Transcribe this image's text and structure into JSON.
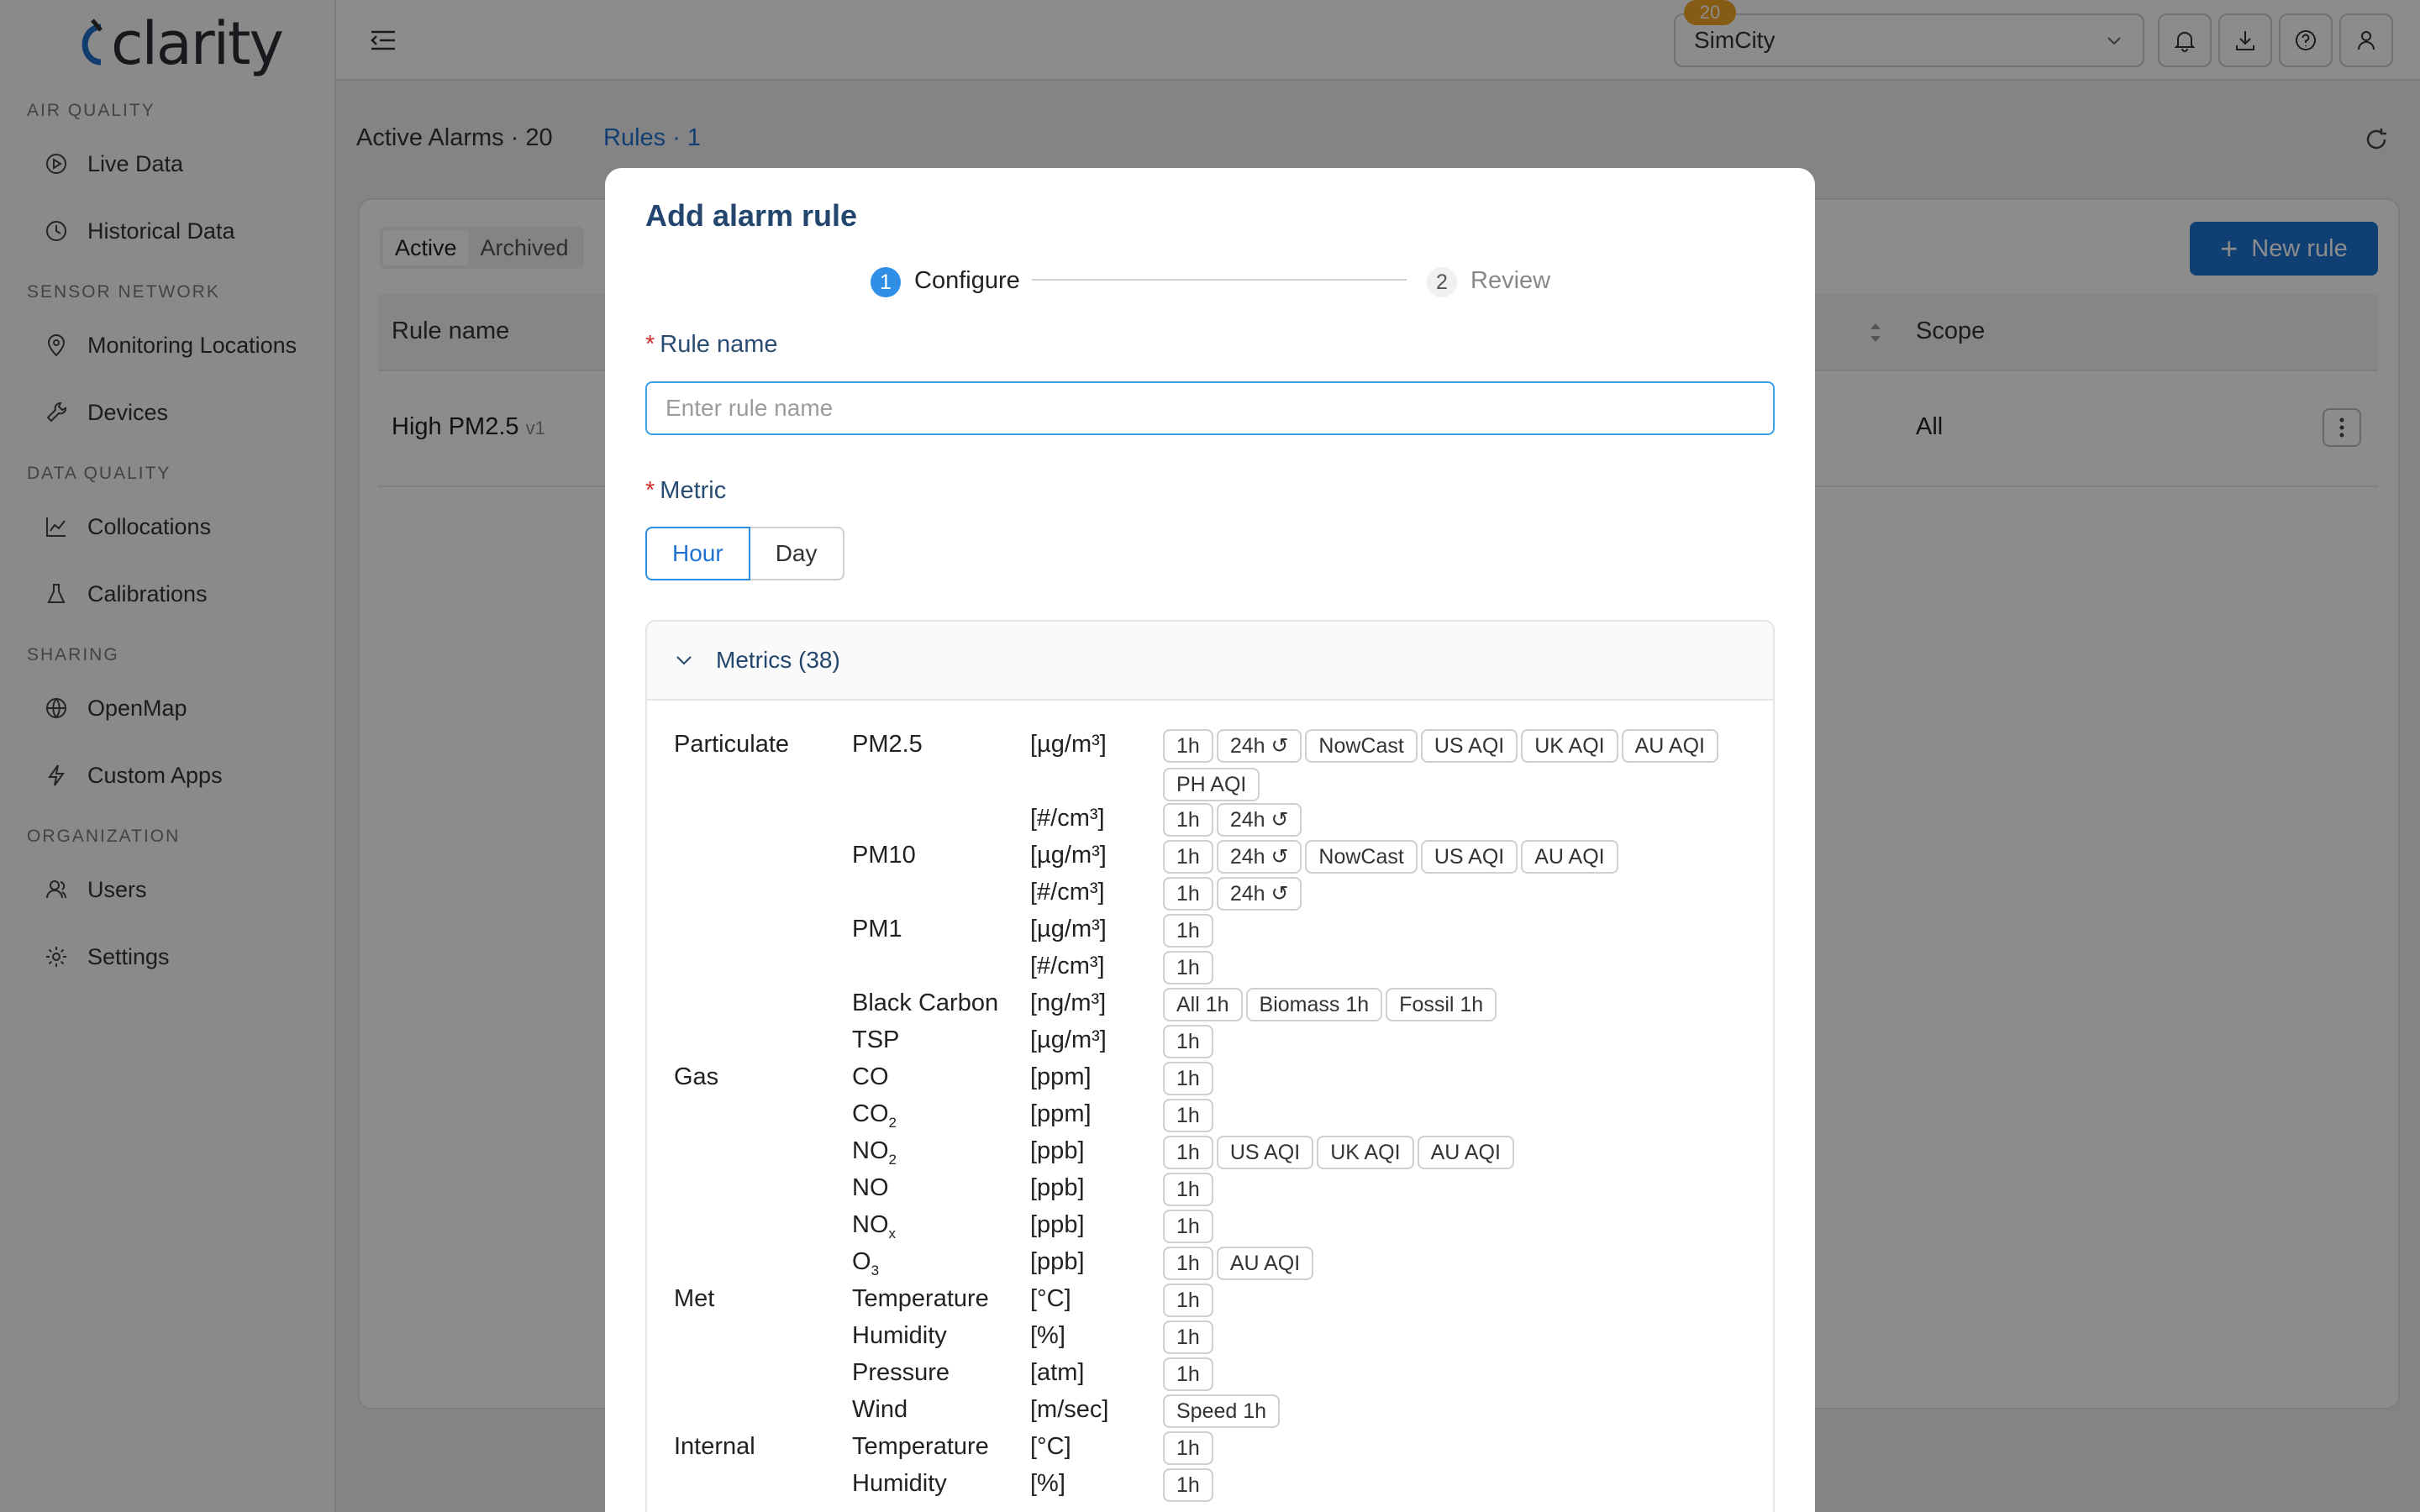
{
  "app": {
    "logo": "clarity"
  },
  "sidebar": {
    "sections": [
      {
        "label": "AIR QUALITY",
        "items": [
          {
            "label": "Live Data",
            "icon": "play-circle-icon"
          },
          {
            "label": "Historical Data",
            "icon": "clock-icon"
          }
        ]
      },
      {
        "label": "SENSOR NETWORK",
        "items": [
          {
            "label": "Monitoring Locations",
            "icon": "location-pin-icon"
          },
          {
            "label": "Devices",
            "icon": "wrench-icon"
          }
        ]
      },
      {
        "label": "DATA QUALITY",
        "items": [
          {
            "label": "Collocations",
            "icon": "line-chart-icon"
          },
          {
            "label": "Calibrations",
            "icon": "flask-icon"
          }
        ]
      },
      {
        "label": "SHARING",
        "items": [
          {
            "label": "OpenMap",
            "icon": "globe-icon"
          },
          {
            "label": "Custom Apps",
            "icon": "bolt-icon"
          }
        ]
      },
      {
        "label": "ORGANIZATION",
        "items": [
          {
            "label": "Users",
            "icon": "users-icon"
          },
          {
            "label": "Settings",
            "icon": "gear-icon"
          }
        ]
      }
    ]
  },
  "topbar": {
    "org": "SimCity",
    "notification_count": "20"
  },
  "page": {
    "tabs": [
      {
        "label": "Active Alarms · 20",
        "active": false
      },
      {
        "label": "Rules · 1",
        "active": true
      }
    ],
    "segments": [
      "Active",
      "Archived"
    ],
    "new_rule": "New rule",
    "columns": {
      "rule_name": "Rule name",
      "scope": "Scope"
    },
    "rows": [
      {
        "name": "High PM2.5",
        "version": "v1",
        "scope": "All"
      }
    ]
  },
  "modal": {
    "title": "Add alarm rule",
    "steps": [
      {
        "num": "1",
        "label": "Configure"
      },
      {
        "num": "2",
        "label": "Review"
      }
    ],
    "rule_name_label": "Rule name",
    "rule_name_placeholder": "Enter rule name",
    "metric_label": "Metric",
    "metric_options": [
      "Hour",
      "Day"
    ],
    "metrics_title": "Metrics (38)",
    "metric_rows": [
      {
        "cat": "Particulate",
        "name": "PM2.5",
        "unit": "[µg/m³]",
        "tags": [
          "1h",
          "24h ↺",
          "NowCast",
          "US AQI",
          "UK AQI",
          "AU AQI",
          "PH AQI"
        ]
      },
      {
        "cat": "",
        "name": "",
        "unit": "[#/cm³]",
        "tags": [
          "1h",
          "24h ↺"
        ]
      },
      {
        "cat": "",
        "name": "PM10",
        "unit": "[µg/m³]",
        "tags": [
          "1h",
          "24h ↺",
          "NowCast",
          "US AQI",
          "AU AQI"
        ]
      },
      {
        "cat": "",
        "name": "",
        "unit": "[#/cm³]",
        "tags": [
          "1h",
          "24h ↺"
        ]
      },
      {
        "cat": "",
        "name": "PM1",
        "unit": "[µg/m³]",
        "tags": [
          "1h"
        ]
      },
      {
        "cat": "",
        "name": "",
        "unit": "[#/cm³]",
        "tags": [
          "1h"
        ]
      },
      {
        "cat": "",
        "name": "Black Carbon",
        "unit": "[ng/m³]",
        "tags": [
          "All 1h",
          "Biomass 1h",
          "Fossil 1h"
        ]
      },
      {
        "cat": "",
        "name": "TSP",
        "unit": "[µg/m³]",
        "tags": [
          "1h"
        ]
      },
      {
        "cat": "Gas",
        "name": "CO",
        "unit": "[ppm]",
        "tags": [
          "1h"
        ]
      },
      {
        "cat": "",
        "name": "CO",
        "sub": "2",
        "unit": "[ppm]",
        "tags": [
          "1h"
        ]
      },
      {
        "cat": "",
        "name": "NO",
        "sub": "2",
        "unit": "[ppb]",
        "tags": [
          "1h",
          "US AQI",
          "UK AQI",
          "AU AQI"
        ]
      },
      {
        "cat": "",
        "name": "NO",
        "unit": "[ppb]",
        "tags": [
          "1h"
        ]
      },
      {
        "cat": "",
        "name": "NO",
        "sub": "x",
        "unit": "[ppb]",
        "tags": [
          "1h"
        ]
      },
      {
        "cat": "",
        "name": "O",
        "sub": "3",
        "unit": "[ppb]",
        "tags": [
          "1h",
          "AU AQI"
        ]
      },
      {
        "cat": "Met",
        "name": "Temperature",
        "unit": "[°C]",
        "tags": [
          "1h"
        ]
      },
      {
        "cat": "",
        "name": "Humidity",
        "unit": "[%]",
        "tags": [
          "1h"
        ]
      },
      {
        "cat": "",
        "name": "Pressure",
        "unit": "[atm]",
        "tags": [
          "1h"
        ]
      },
      {
        "cat": "",
        "name": "Wind",
        "unit": "[m/sec]",
        "tags": [
          "Speed 1h"
        ]
      },
      {
        "cat": "Internal",
        "name": "Temperature",
        "unit": "[°C]",
        "tags": [
          "1h"
        ]
      },
      {
        "cat": "",
        "name": "Humidity",
        "unit": "[%]",
        "tags": [
          "1h"
        ]
      }
    ]
  },
  "colors": {
    "accent": "#1e73d2",
    "badge": "#f5a623",
    "title": "#23466e"
  }
}
